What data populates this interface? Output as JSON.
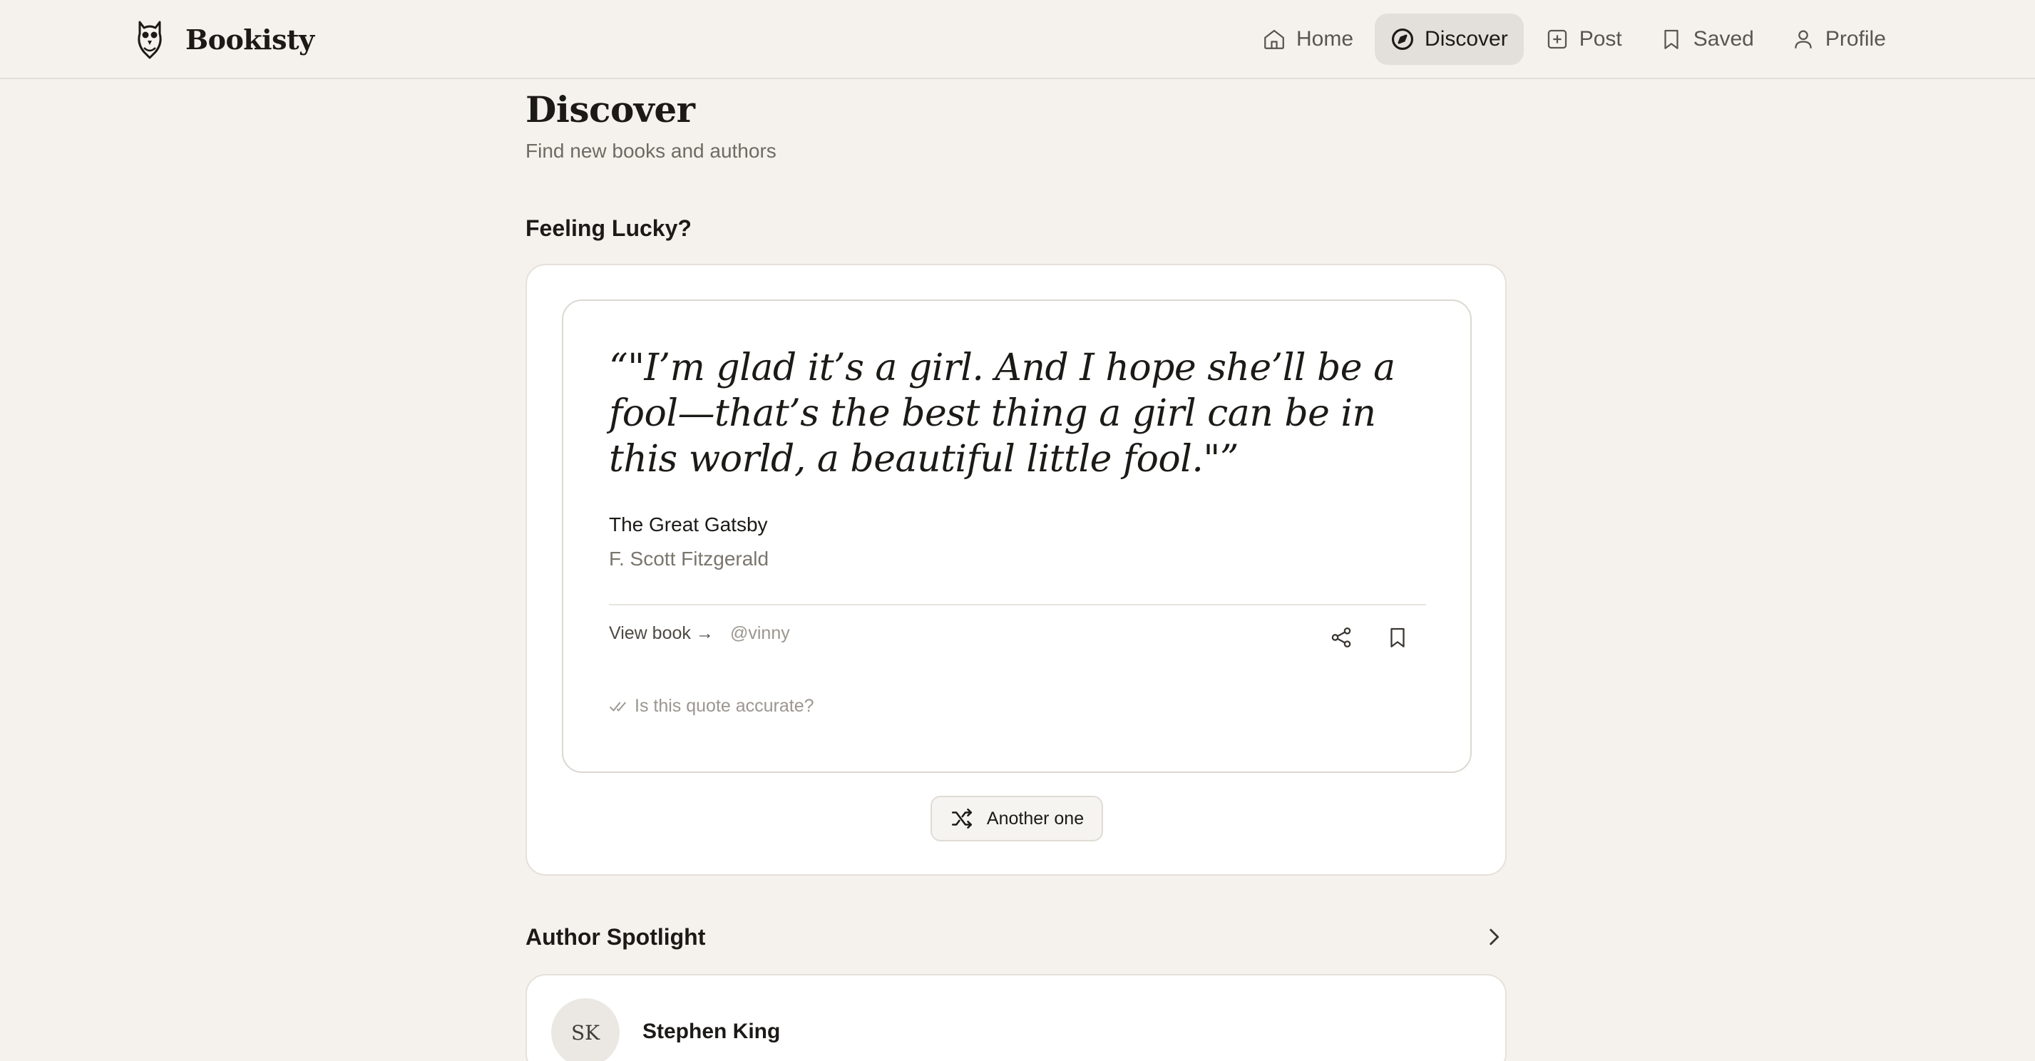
{
  "app": {
    "name": "Bookisty",
    "logo_icon": "owl-icon"
  },
  "nav": {
    "items": [
      {
        "label": "Home",
        "icon": "home-icon",
        "active": false
      },
      {
        "label": "Discover",
        "icon": "compass-icon",
        "active": true
      },
      {
        "label": "Post",
        "icon": "plus-square-icon",
        "active": false
      },
      {
        "label": "Saved",
        "icon": "bookmark-icon",
        "active": false
      },
      {
        "label": "Profile",
        "icon": "user-icon",
        "active": false
      }
    ]
  },
  "page": {
    "title": "Discover",
    "subtitle": "Find new books and authors"
  },
  "feeling_lucky": {
    "heading": "Feeling Lucky?",
    "quote": {
      "text": "“\"I’m glad it’s a girl. And I hope she’ll be a fool—that’s the best thing a girl can be in this world, a beautiful little fool.\"”",
      "book_title": "The Great Gatsby",
      "author": "F. Scott Fitzgerald",
      "view_book_label": "View book →",
      "username": "@vinny",
      "accuracy_prompt": "Is this quote accurate?"
    },
    "another_button_label": "Another one"
  },
  "author_spotlight": {
    "heading": "Author Spotlight",
    "author": {
      "initials": "SK",
      "name": "Stephen King"
    }
  },
  "colors": {
    "background": "#f5f2ed",
    "card": "#ffffff",
    "active_nav": "#e3e0db",
    "text_primary": "#1c1a17",
    "text_muted": "#7a756e"
  }
}
